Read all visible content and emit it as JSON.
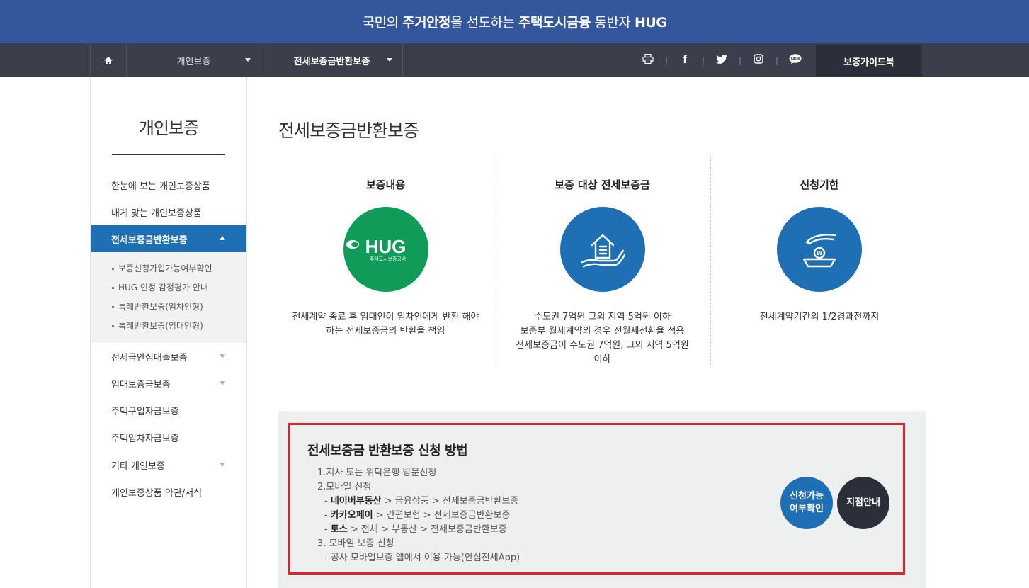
{
  "banner": {
    "p1": "국민의 ",
    "b1": "주거안정",
    "p2": "을 선도하는 ",
    "b2": "주택도시금융",
    "p3": " 동반자 ",
    "b3": "HUG"
  },
  "gnb": {
    "home_icon": "home-icon",
    "menu1": "개인보증",
    "menu2": "전세보증금반환보증",
    "social": [
      "print-icon",
      "facebook-icon",
      "twitter-icon",
      "instagram-icon",
      "kakaotalk-icon"
    ],
    "sep": "|",
    "guide_label": "보증가이드북"
  },
  "sidebar": {
    "title": "개인보증",
    "items": [
      {
        "label": "한눈에 보는 개인보증상품"
      },
      {
        "label": "내게 맞는 개인보증상품"
      },
      {
        "label": "전세보증금반환보증"
      },
      {
        "label": "전세금안심대출보증"
      },
      {
        "label": "임대보증금보증"
      },
      {
        "label": "주택구입자금보증"
      },
      {
        "label": "주택임차자금보증"
      },
      {
        "label": "기타 개인보증"
      },
      {
        "label": "개인보증상품 약관/서식"
      }
    ],
    "sub_items": [
      {
        "label": "보증신청가입가능여부확인"
      },
      {
        "label": "HUG 인정 감정평가 안내"
      },
      {
        "label": "특례반환보증(임차인형)"
      },
      {
        "label": "특례반환보증(임대인형)"
      }
    ]
  },
  "main": {
    "title": "전세보증금반환보증",
    "columns": [
      {
        "heading": "보증내용",
        "logo_text": "HUG",
        "logo_sub": "주택도시보증공사",
        "line1": "전세계약 종료 후 임대인이 임차인에게 반환 해야",
        "line2": "하는 전세보증금의 반환을 책임"
      },
      {
        "heading": "보증 대상 전세보증금",
        "line1": "수도권 7억원 그외 지역 5억원 이하",
        "line2": "보증부 월세계약의 경우 전월세전환율 적용",
        "line3": "전세보증금이 수도권 7억원, 그외 지역 5억원",
        "line4": "이하"
      },
      {
        "heading": "신청기한",
        "line1": "전세계약기간의 1/2경과전까지"
      }
    ]
  },
  "howto": {
    "title": "전세보증금 반환보증 신청 방법",
    "l1": "1.지사 또는 위탁은행 방문신청",
    "l2": "2.모바일 신청",
    "l3_dash": "- ",
    "l3_b": "네이버부동산",
    "l3_rest": " > 금융상품 > 전세보증금반환보증",
    "l4_dash": "- ",
    "l4_b": "카카오페이",
    "l4_rest": " > 간편보험 > 전세보증금반환보증",
    "l5_dash": "- ",
    "l5_b": "토스",
    "l5_rest": " > 전체 > 부동산 > 전세보증금반환보증",
    "l6": "3. 모바일 보증 신청",
    "l7": "- 공사 모바일보증 앱에서 이용 가능(안심전세App)",
    "btn1_line1": "신청가능",
    "btn1_line2": "여부확인",
    "btn2": "지점안내"
  }
}
